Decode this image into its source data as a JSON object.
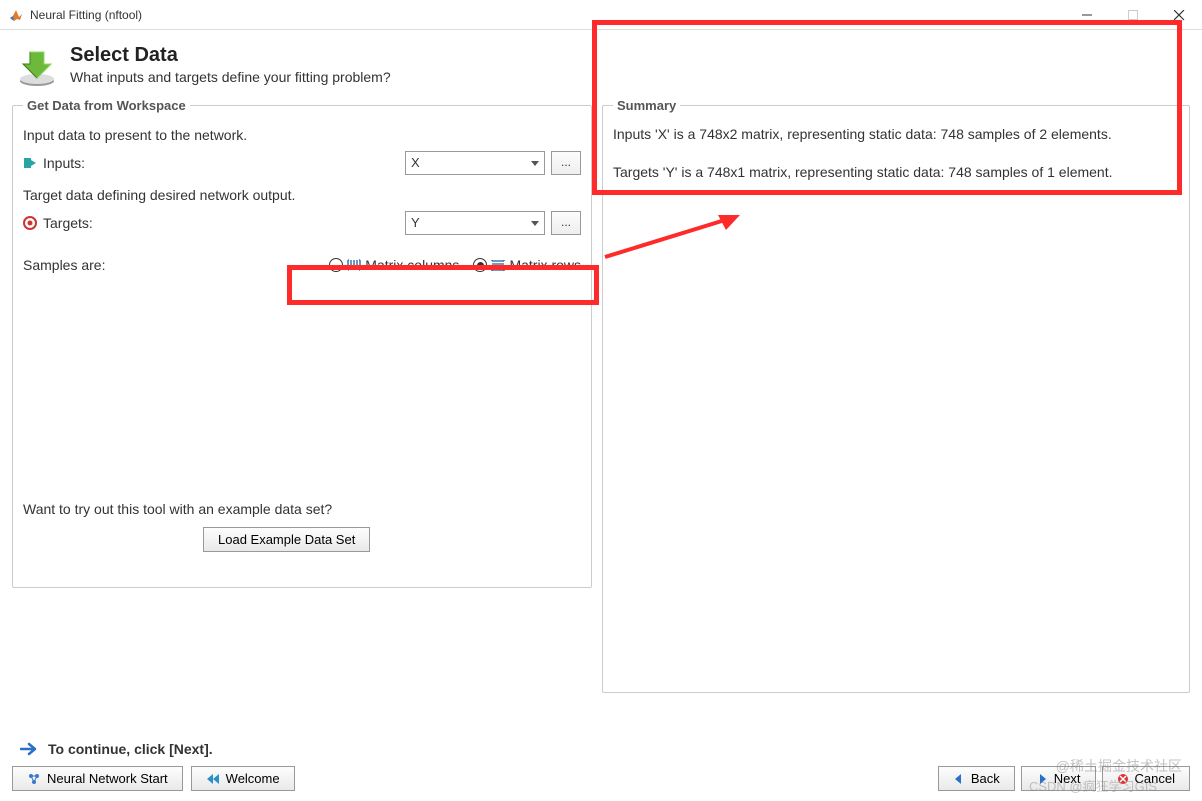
{
  "window": {
    "title": "Neural Fitting (nftool)"
  },
  "header": {
    "title": "Select Data",
    "subtitle": "What inputs and targets define your fitting problem?"
  },
  "leftPanel": {
    "legend": "Get Data from Workspace",
    "inputDesc": "Input data to present to the network.",
    "inputsLabel": "Inputs:",
    "inputsValue": "X",
    "targetDesc": "Target data defining desired network output.",
    "targetsLabel": "Targets:",
    "targetsValue": "Y",
    "browse": "...",
    "samplesLabel": "Samples are:",
    "radioColumns": "Matrix columns",
    "radioRows": "Matrix rows",
    "examplePrompt": "Want to try out this tool with an example data set?",
    "loadExample": "Load Example Data Set"
  },
  "rightPanel": {
    "legend": "Summary",
    "inputsSummary": "Inputs 'X' is a 748x2 matrix, representing static data: 748 samples of 2 elements.",
    "targetsSummary": "Targets 'Y' is a 748x1 matrix, representing static data: 748 samples of 1 element."
  },
  "footer": {
    "hint": "To continue, click [Next].",
    "nnStart": "Neural Network Start",
    "welcome": "Welcome",
    "back": "Back",
    "next": "Next",
    "cancel": "Cancel"
  },
  "watermark": {
    "line1": "@稀土掘金技术社区",
    "line2": "CSDN @疯狂学习GIS"
  }
}
